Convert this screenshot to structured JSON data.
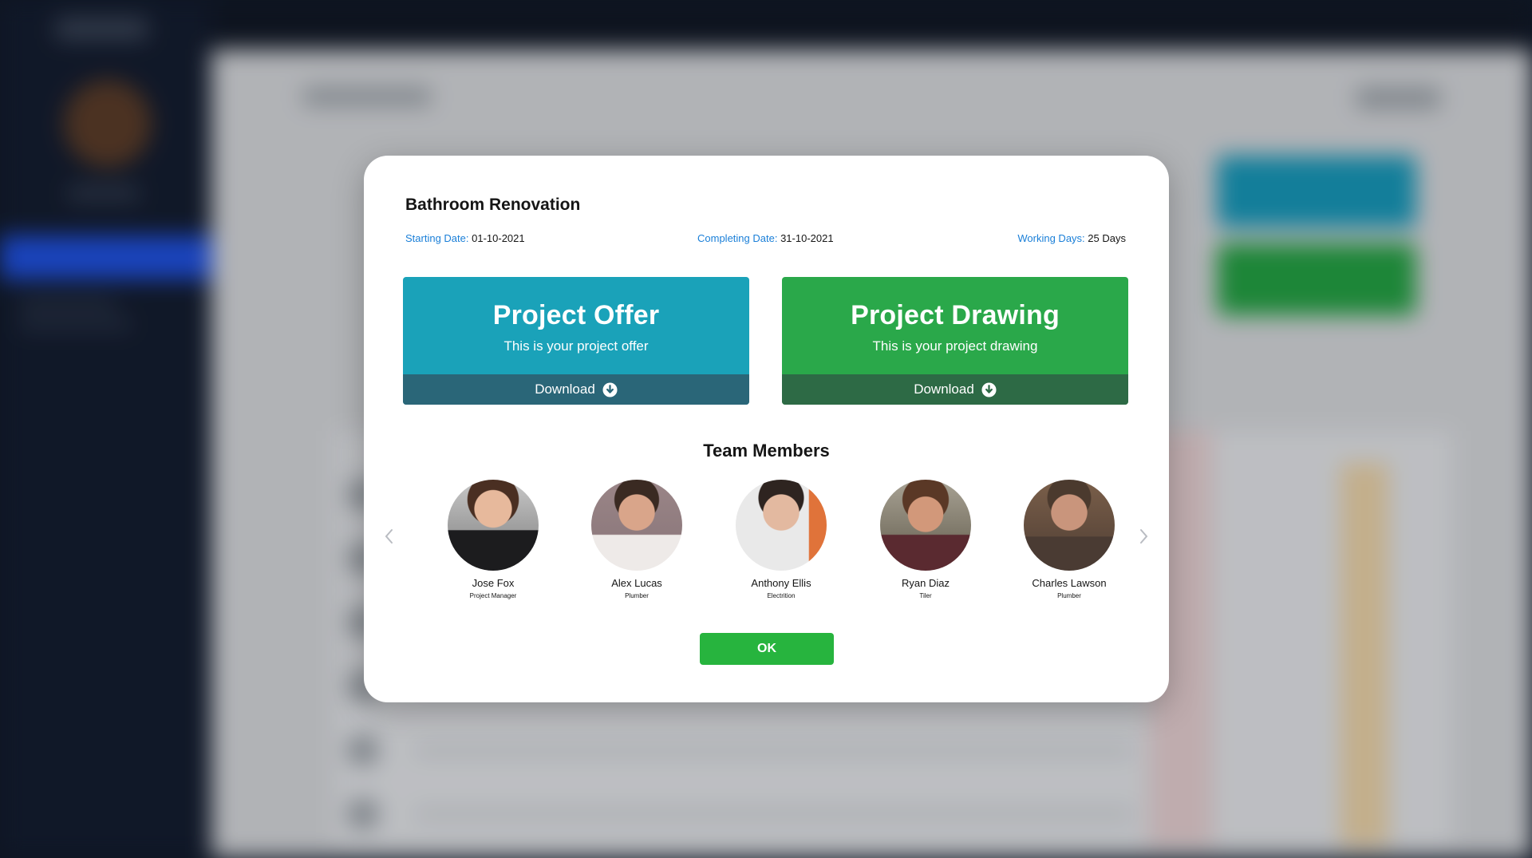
{
  "modal": {
    "title": "Bathroom Renovation",
    "starting_date_label": "Starting Date:",
    "starting_date_value": "01-10-2021",
    "completing_date_label": "Completing Date:",
    "completing_date_value": "31-10-2021",
    "working_days_label": "Working Days:",
    "working_days_value": "25 Days"
  },
  "cards": {
    "offer": {
      "title": "Project Offer",
      "subtitle": "This is your project offer",
      "download_label": "Download",
      "color": "#1aa2b9"
    },
    "drawing": {
      "title": "Project Drawing",
      "subtitle": "This is your project drawing",
      "download_label": "Download",
      "color": "#2aa84a"
    }
  },
  "team": {
    "heading": "Team Members",
    "members": [
      {
        "name": "Jose Fox",
        "role": "Project Manager"
      },
      {
        "name": "Alex Lucas",
        "role": "Plumber"
      },
      {
        "name": "Anthony Ellis",
        "role": "Electrition"
      },
      {
        "name": "Ryan Diaz",
        "role": "Tiler"
      },
      {
        "name": "Charles Lawson",
        "role": "Plumber"
      }
    ]
  },
  "ok_label": "OK",
  "icons": {
    "download": "download-circle-icon",
    "prev": "chevron-left-icon",
    "next": "chevron-right-icon"
  },
  "colors": {
    "accent_blue": "#1a7fd8",
    "ok_green": "#27b43e"
  }
}
